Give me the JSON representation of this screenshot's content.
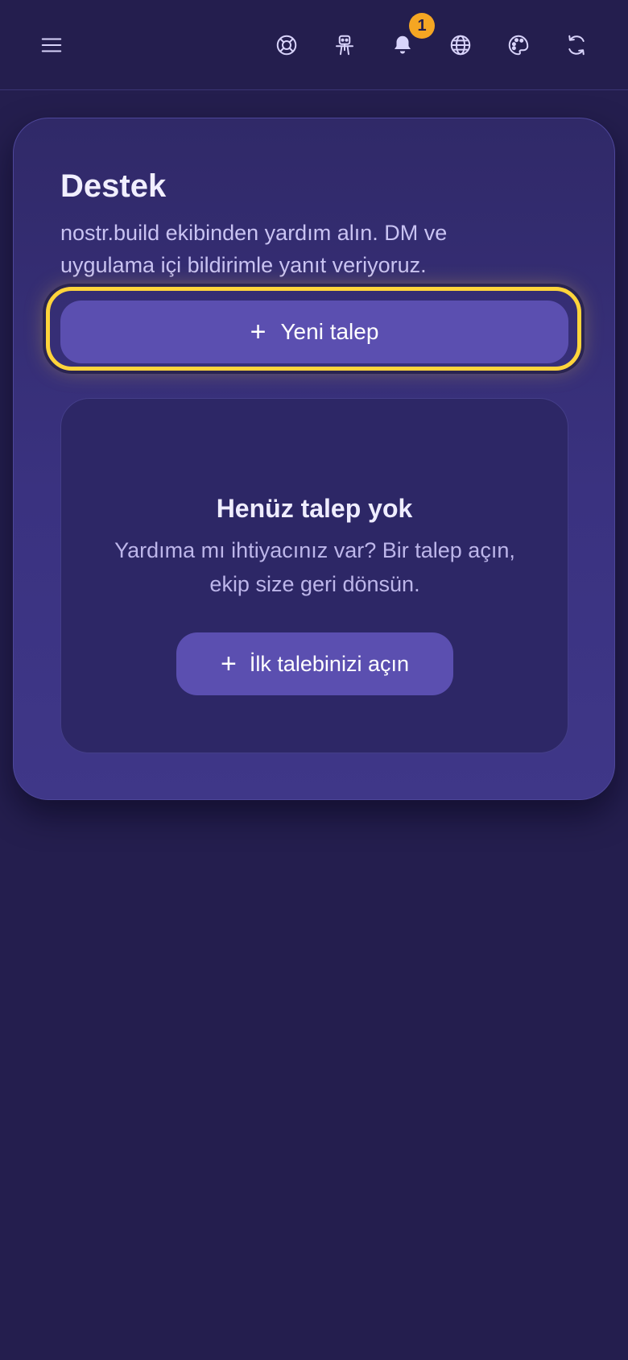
{
  "topbar": {
    "menu_icon": "hamburger-icon",
    "icons": [
      "lifebuoy-icon",
      "robot-icon",
      "bell-icon",
      "globe-icon",
      "palette-icon",
      "refresh-icon"
    ],
    "notification_count": "1"
  },
  "support": {
    "title": "Destek",
    "subtitle": "nostr.build ekibinden yardım alın. DM ve uygulama içi bildirimle yanıt veriyoruz.",
    "new_ticket_label": "Yeni talep",
    "empty": {
      "title": "Henüz talep yok",
      "text": "Yardıma mı ihtiyacınız var? Bir talep açın, ekip size geri dönsün.",
      "cta_label": "İlk talebinizi açın"
    }
  },
  "colors": {
    "background": "#241e4e",
    "card": "#332b70",
    "accent_button": "#5b4fb0",
    "focus_ring": "#ffd43b",
    "badge": "#f5a623"
  }
}
